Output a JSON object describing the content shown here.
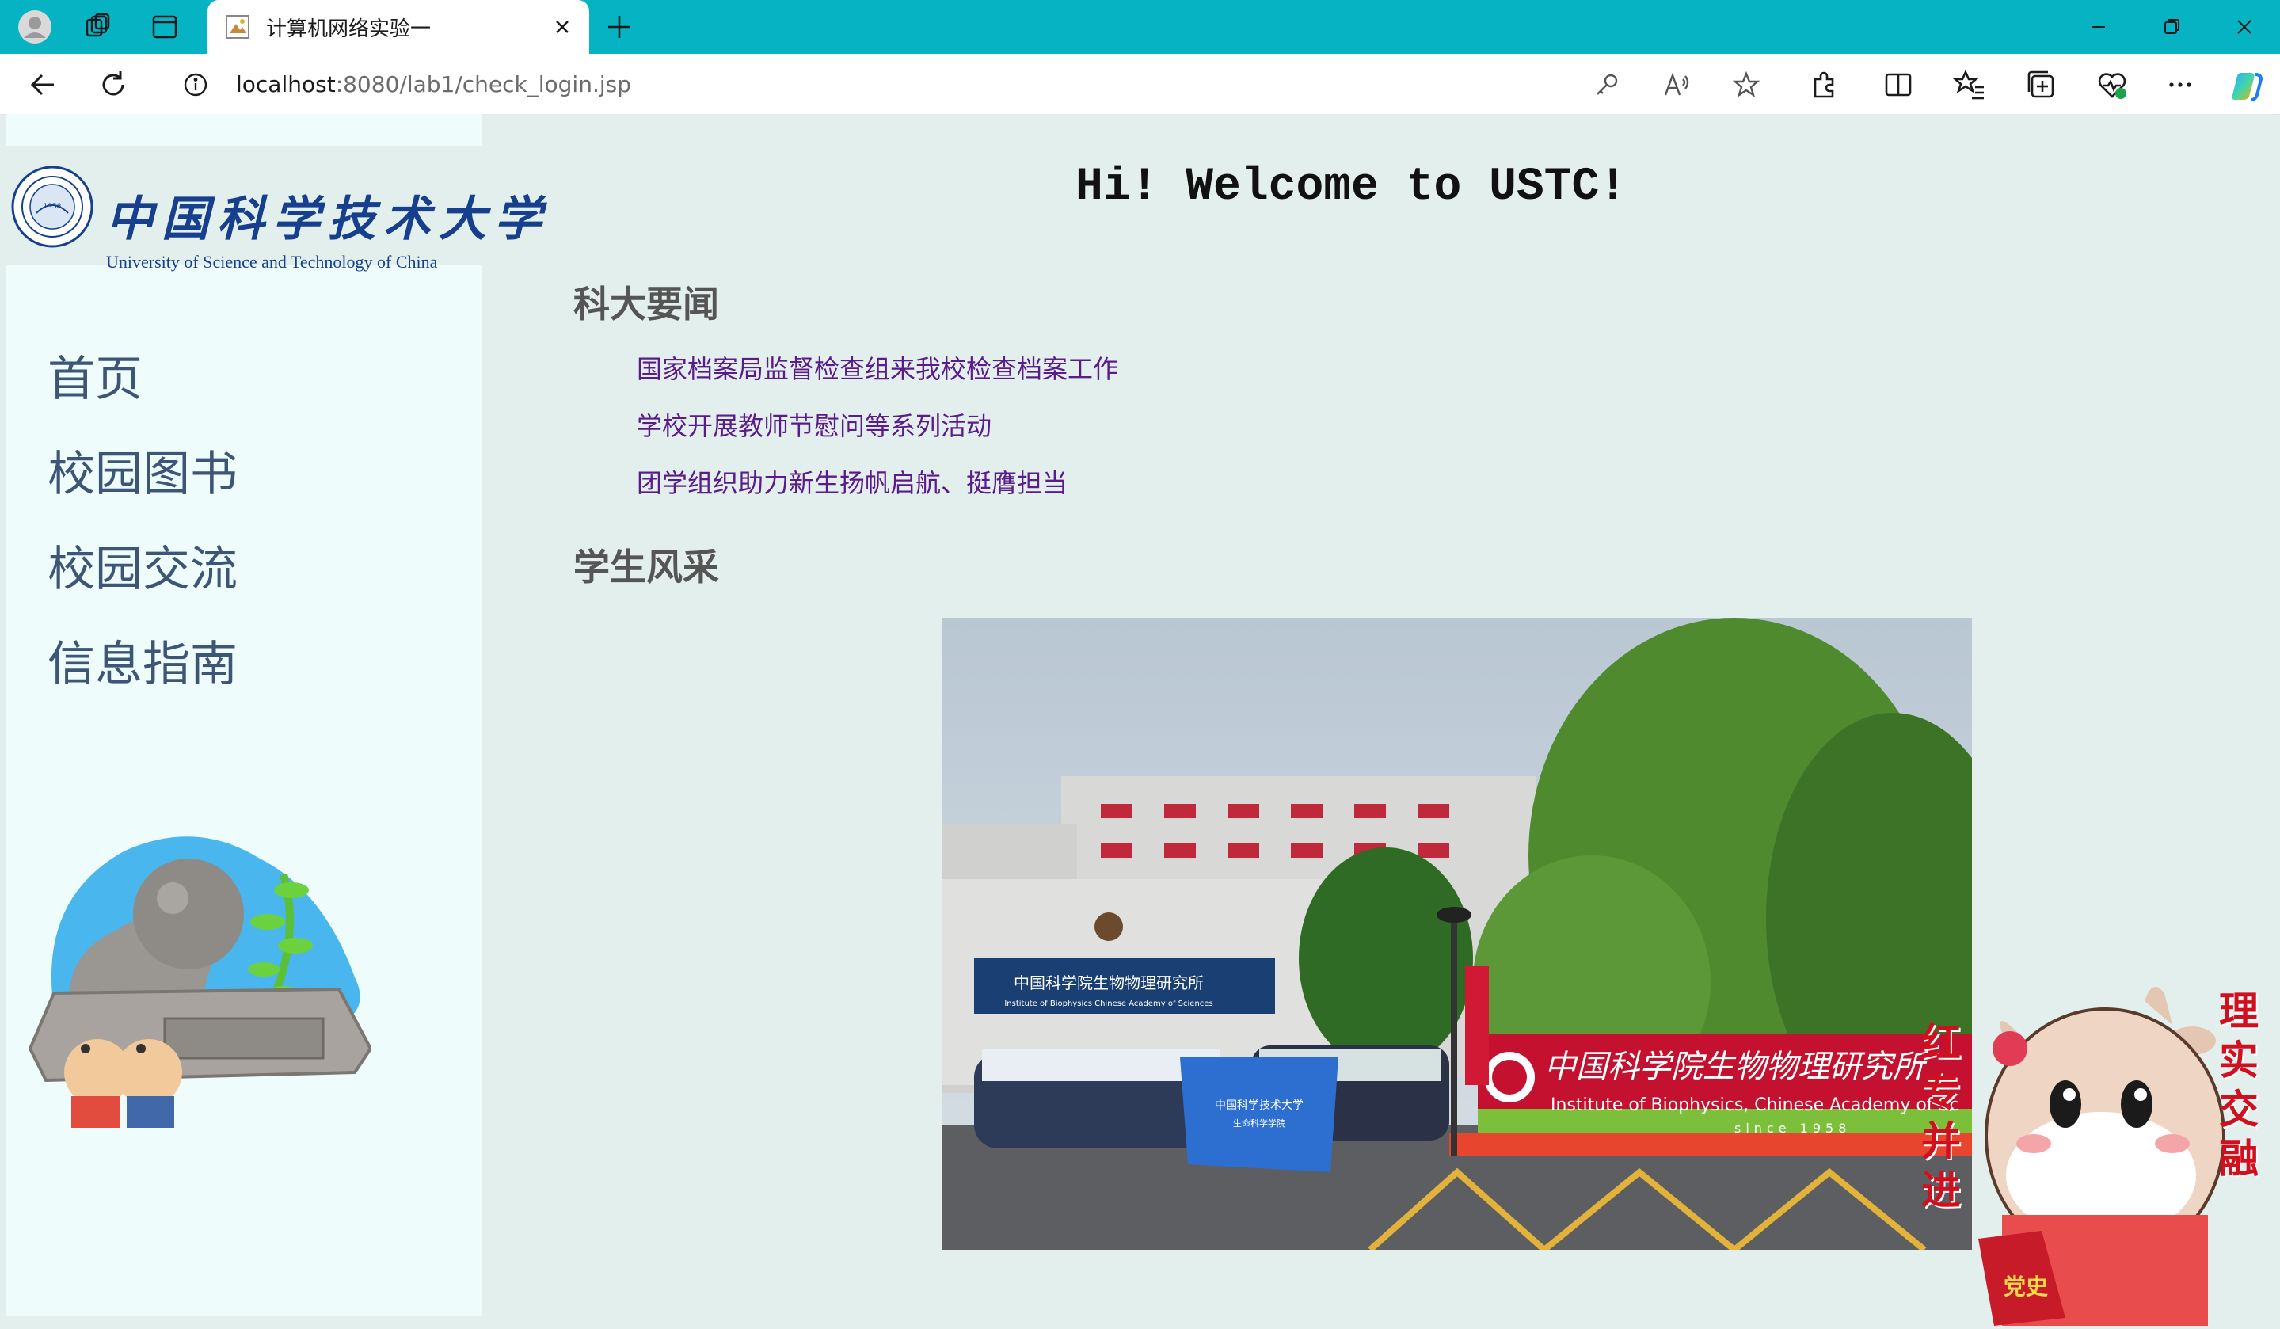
{
  "browser": {
    "tab_title": "计算机网络实验一",
    "url_host": "localhost",
    "url_rest": ":8080/lab1/check_login.jsp"
  },
  "logo": {
    "cn": "中国科学技术大学",
    "en": "University of Science and Technology of China",
    "emblem_year": "1958"
  },
  "nav": {
    "items": [
      {
        "label": "首页"
      },
      {
        "label": "校园图书"
      },
      {
        "label": "校园交流"
      },
      {
        "label": "信息指南"
      }
    ]
  },
  "main": {
    "welcome": "Hi! Welcome to USTC!",
    "news_heading": "科大要闻",
    "news": [
      {
        "title": "国家档案局监督检查组来我校检查档案工作"
      },
      {
        "title": "学校开展教师节慰问等系列活动"
      },
      {
        "title": "团学组织助力新生扬帆启航、挺膺担当"
      }
    ],
    "students_heading": "学生风采",
    "photo": {
      "sign_cn": "中国科学院生物物理研究所",
      "sign_en": "Institute of Biophysics, Chinese Academy of Sc",
      "sign_since": "since 1958",
      "building_sign_cn": "中国科学院生物物理研究所",
      "building_sign_en": "Institute of Biophysics Chinese Academy of Sciences",
      "banner_cn": "中国科学技术大学",
      "banner_sub": "生命科学学院"
    },
    "cow_left_text": "红专并进",
    "cow_right_text": "理实交融",
    "cow_book": "党史"
  },
  "colors": {
    "tabbar": "#06b3c3",
    "sidebar": "#eefdfb",
    "page_bg": "#e3efed",
    "link": "#5a1b8b",
    "nav_text": "#3d5577",
    "logo_blue": "#16408e"
  }
}
